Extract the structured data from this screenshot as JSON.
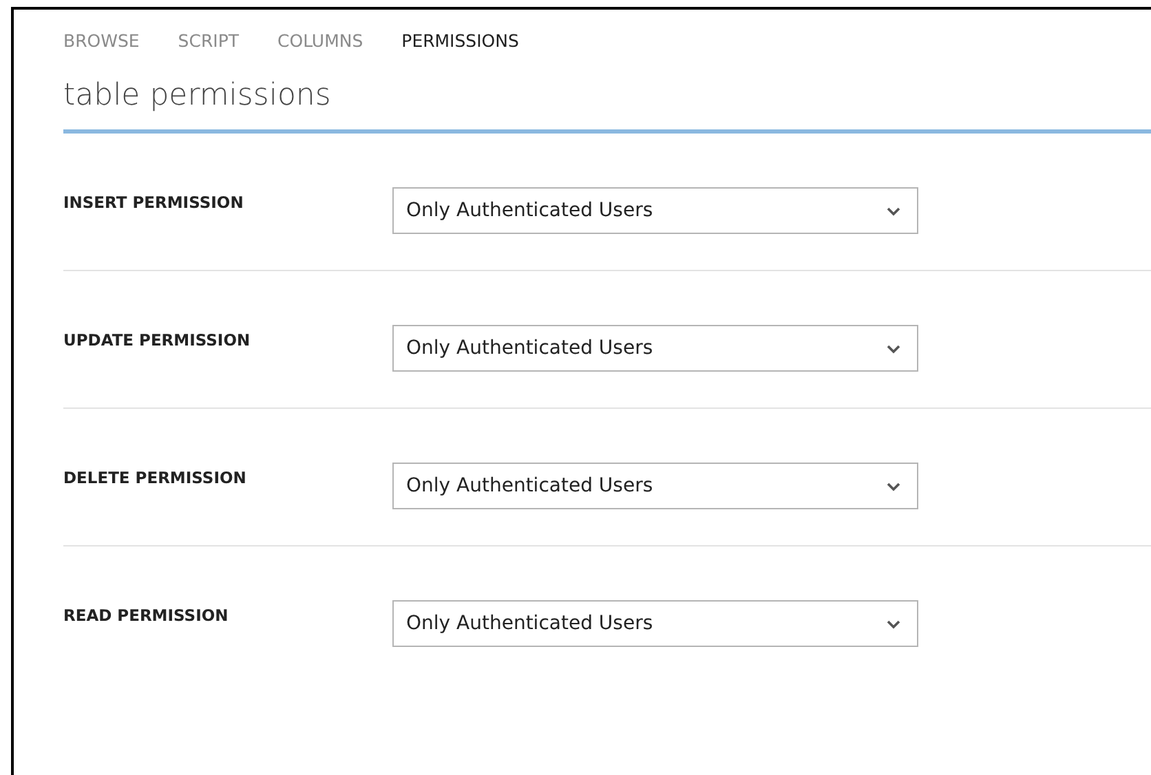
{
  "tabs": [
    {
      "label": "BROWSE",
      "selected": false
    },
    {
      "label": "SCRIPT",
      "selected": false
    },
    {
      "label": "COLUMNS",
      "selected": false
    },
    {
      "label": "PERMISSIONS",
      "selected": true
    }
  ],
  "title": "table permissions",
  "permissions": [
    {
      "label": "INSERT PERMISSION",
      "value": "Only Authenticated Users"
    },
    {
      "label": "UPDATE PERMISSION",
      "value": "Only Authenticated Users"
    },
    {
      "label": "DELETE PERMISSION",
      "value": "Only Authenticated Users"
    },
    {
      "label": "READ PERMISSION",
      "value": "Only Authenticated Users"
    }
  ]
}
